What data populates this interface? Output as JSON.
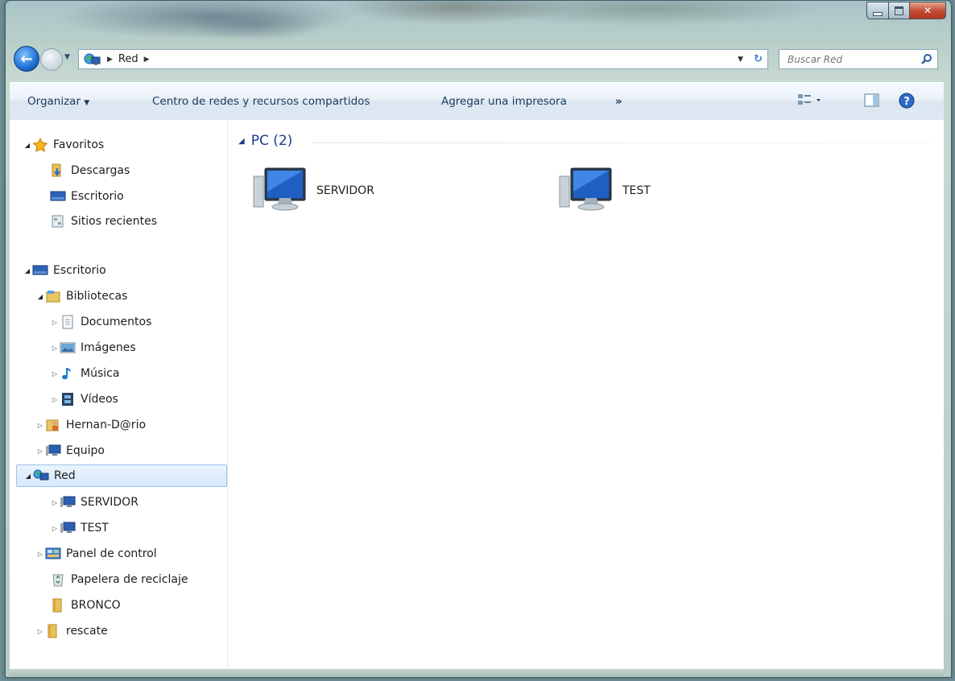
{
  "address": {
    "breadcrumb": [
      "Red"
    ],
    "search_placeholder": "Buscar Red"
  },
  "toolbar": {
    "organize": "Organizar",
    "network_center": "Centro de redes y recursos compartidos",
    "add_printer": "Agregar una impresora",
    "more": "»"
  },
  "navpane": {
    "favorites": "Favoritos",
    "fav_items": [
      "Descargas",
      "Escritorio",
      "Sitios recientes"
    ],
    "desktop": "Escritorio",
    "libraries": "Bibliotecas",
    "lib_items": [
      "Documentos",
      "Imágenes",
      "Música",
      "Vídeos"
    ],
    "user": "Hernan-D@rio",
    "computer": "Equipo",
    "network": "Red",
    "net_items": [
      "SERVIDOR",
      "TEST"
    ],
    "control_panel": "Panel de control",
    "recycle_bin": "Papelera de reciclaje",
    "folders": [
      "BRONCO",
      "rescate"
    ]
  },
  "main": {
    "group_header": "PC (2)",
    "computers": [
      "SERVIDOR",
      "TEST"
    ]
  },
  "colors": {
    "accent": "#1e3c8c",
    "selection": "#d5e8fb"
  }
}
